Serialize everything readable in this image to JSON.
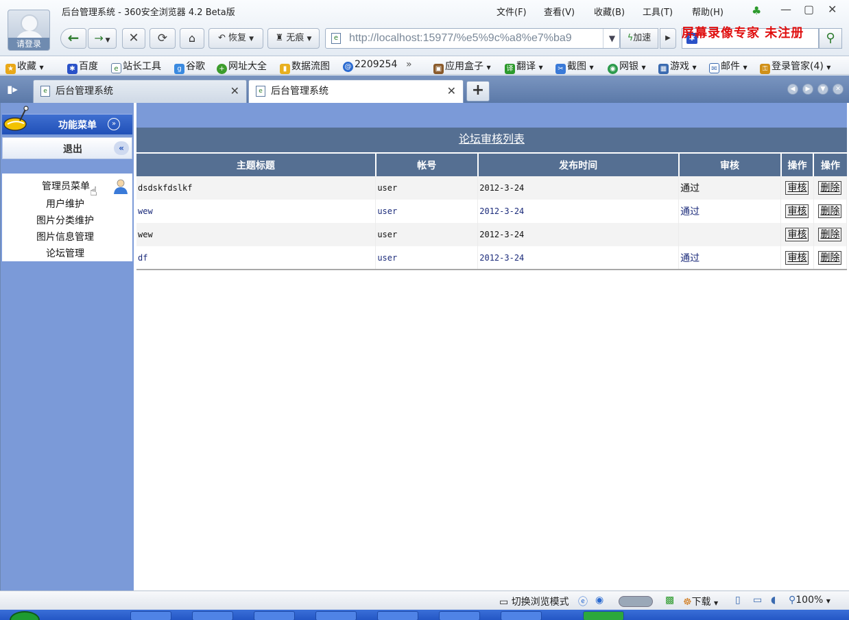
{
  "window": {
    "title": "后台管理系统 - 360安全浏览器 4.2 Beta版",
    "avatar_label": "请登录",
    "menu": [
      "文件(F)",
      "查看(V)",
      "收藏(B)",
      "工具(T)",
      "帮助(H)"
    ],
    "controls": [
      "—",
      "▢",
      "✕"
    ]
  },
  "navbar": {
    "restore_label": "恢复",
    "trace_label": "无痕",
    "address_url": "http://localhost:15977/%e5%9c%a8%e7%ba9",
    "speed_label": "加速",
    "watermark": "屏幕录像专家 未注册"
  },
  "favorites": [
    {
      "label": "收藏",
      "dropdown": true
    },
    {
      "label": "百度"
    },
    {
      "label": "站长工具"
    },
    {
      "label": "谷歌"
    },
    {
      "label": "网址大全"
    },
    {
      "label": "数据流图"
    },
    {
      "label": "2209254"
    },
    {
      "label": "应用盒子",
      "dropdown": true
    },
    {
      "label": "翻译",
      "dropdown": true
    },
    {
      "label": "截图",
      "dropdown": true
    },
    {
      "label": "网银",
      "dropdown": true
    },
    {
      "label": "游戏",
      "dropdown": true
    },
    {
      "label": "邮件",
      "dropdown": true
    },
    {
      "label": "登录管家(4)",
      "dropdown": true
    }
  ],
  "tabs": [
    {
      "label": "后台管理系统",
      "active": false
    },
    {
      "label": "后台管理系统",
      "active": true
    }
  ],
  "sidebar": {
    "header": "功能菜单",
    "logout": "退出",
    "group": "管理员菜单",
    "items": [
      "用户维护",
      "图片分类维护",
      "图片信息管理",
      "论坛管理"
    ]
  },
  "main": {
    "list_title": "论坛审核列表",
    "columns": [
      "主题标题",
      "帐号",
      "发布时间",
      "审核",
      "操作",
      "操作"
    ],
    "action_review": "审核",
    "action_delete": "删除",
    "rows": [
      {
        "title": "dsdskfdslkf",
        "account": "user",
        "date": "2012-3-24",
        "status": "通过"
      },
      {
        "title": "wew",
        "account": "user",
        "date": "2012-3-24",
        "status": "通过"
      },
      {
        "title": "wew",
        "account": "user",
        "date": "2012-3-24",
        "status": ""
      },
      {
        "title": "df",
        "account": "user",
        "date": "2012-3-24",
        "status": "通过"
      }
    ]
  },
  "statusbar": {
    "switch_mode": "切换浏览模式",
    "download": "下载",
    "zoom": "100%"
  }
}
